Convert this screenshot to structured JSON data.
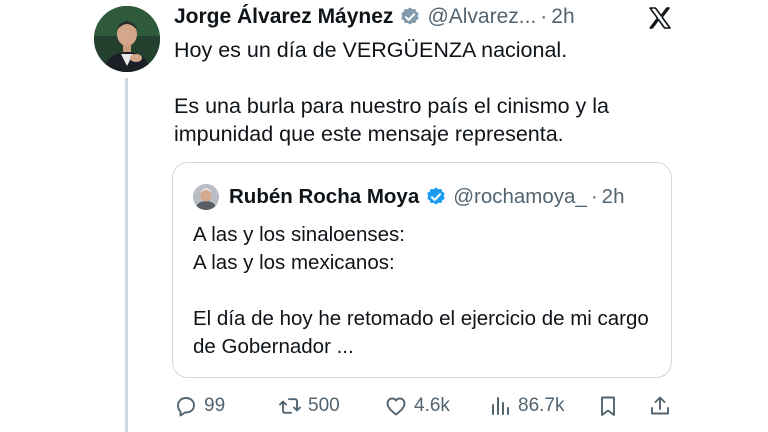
{
  "tweet": {
    "author_name": "Jorge Álvarez Máynez",
    "handle": "@Alvarez...",
    "separator": "·",
    "time": "2h",
    "text_line1": "Hoy es un día de VERGÜENZA nacional.",
    "text_line2": "Es una burla para nuestro país el cinismo y la impunidad que este mensaje representa."
  },
  "quote": {
    "author_name": "Rubén Rocha Moya",
    "handle": "@rochamoya_",
    "separator": "·",
    "time": "2h",
    "line1": "A las y los sinaloenses:",
    "line2": "A las y los mexicanos:",
    "line3": "El día de hoy he retomado el ejercicio de mi cargo de Gobernador ..."
  },
  "actions": {
    "replies": "99",
    "reposts": "500",
    "likes": "4.6k",
    "views": "86.7k"
  },
  "colors": {
    "verified": "#1d9bf0",
    "secondary_text": "#536471",
    "border": "#cfd9de"
  },
  "icons": [
    "verified-badge-icon",
    "x-logo-icon",
    "reply-icon",
    "repost-icon",
    "like-icon",
    "views-icon",
    "bookmark-icon",
    "share-icon"
  ]
}
